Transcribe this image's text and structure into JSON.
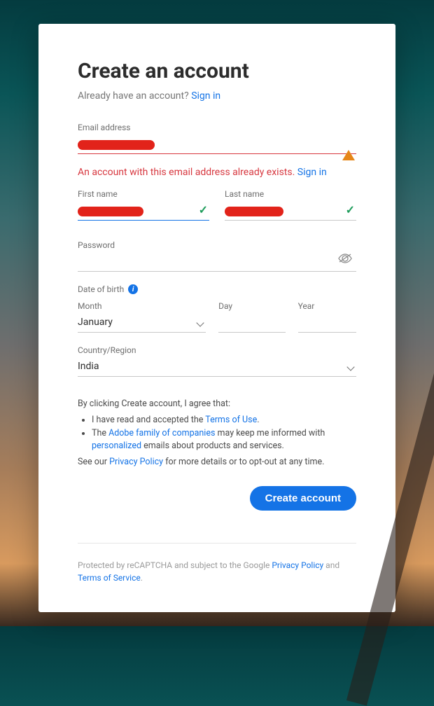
{
  "title": "Create an account",
  "prompt": "Already have an account? ",
  "sign_in_link": "Sign in",
  "email": {
    "label": "Email address",
    "error_text": "An account with this email address already exists. ",
    "error_link": "Sign in"
  },
  "first_name": {
    "label": "First name"
  },
  "last_name": {
    "label": "Last name"
  },
  "password": {
    "label": "Password"
  },
  "dob": {
    "label": "Date of birth",
    "month_label": "Month",
    "month_value": "January",
    "day_label": "Day",
    "year_label": "Year"
  },
  "country": {
    "label": "Country/Region",
    "value": "India"
  },
  "legal": {
    "intro": "By clicking Create account, I agree that:",
    "li1a": "I have read and accepted the ",
    "li1b": "Terms of Use",
    "li1c": ".",
    "li2a": "The ",
    "li2b": "Adobe family of companies",
    "li2c": " may keep me informed with ",
    "li2d": "personalized",
    "li2e": " emails about products and services.",
    "outro_a": "See our ",
    "outro_b": "Privacy Policy",
    "outro_c": " for more details or to opt-out at any time."
  },
  "submit": "Create account",
  "footer": {
    "a": "Protected by reCAPTCHA and subject to the Google ",
    "b": "Privacy Policy",
    "c": " and ",
    "d": "Terms of Service",
    "e": "."
  }
}
